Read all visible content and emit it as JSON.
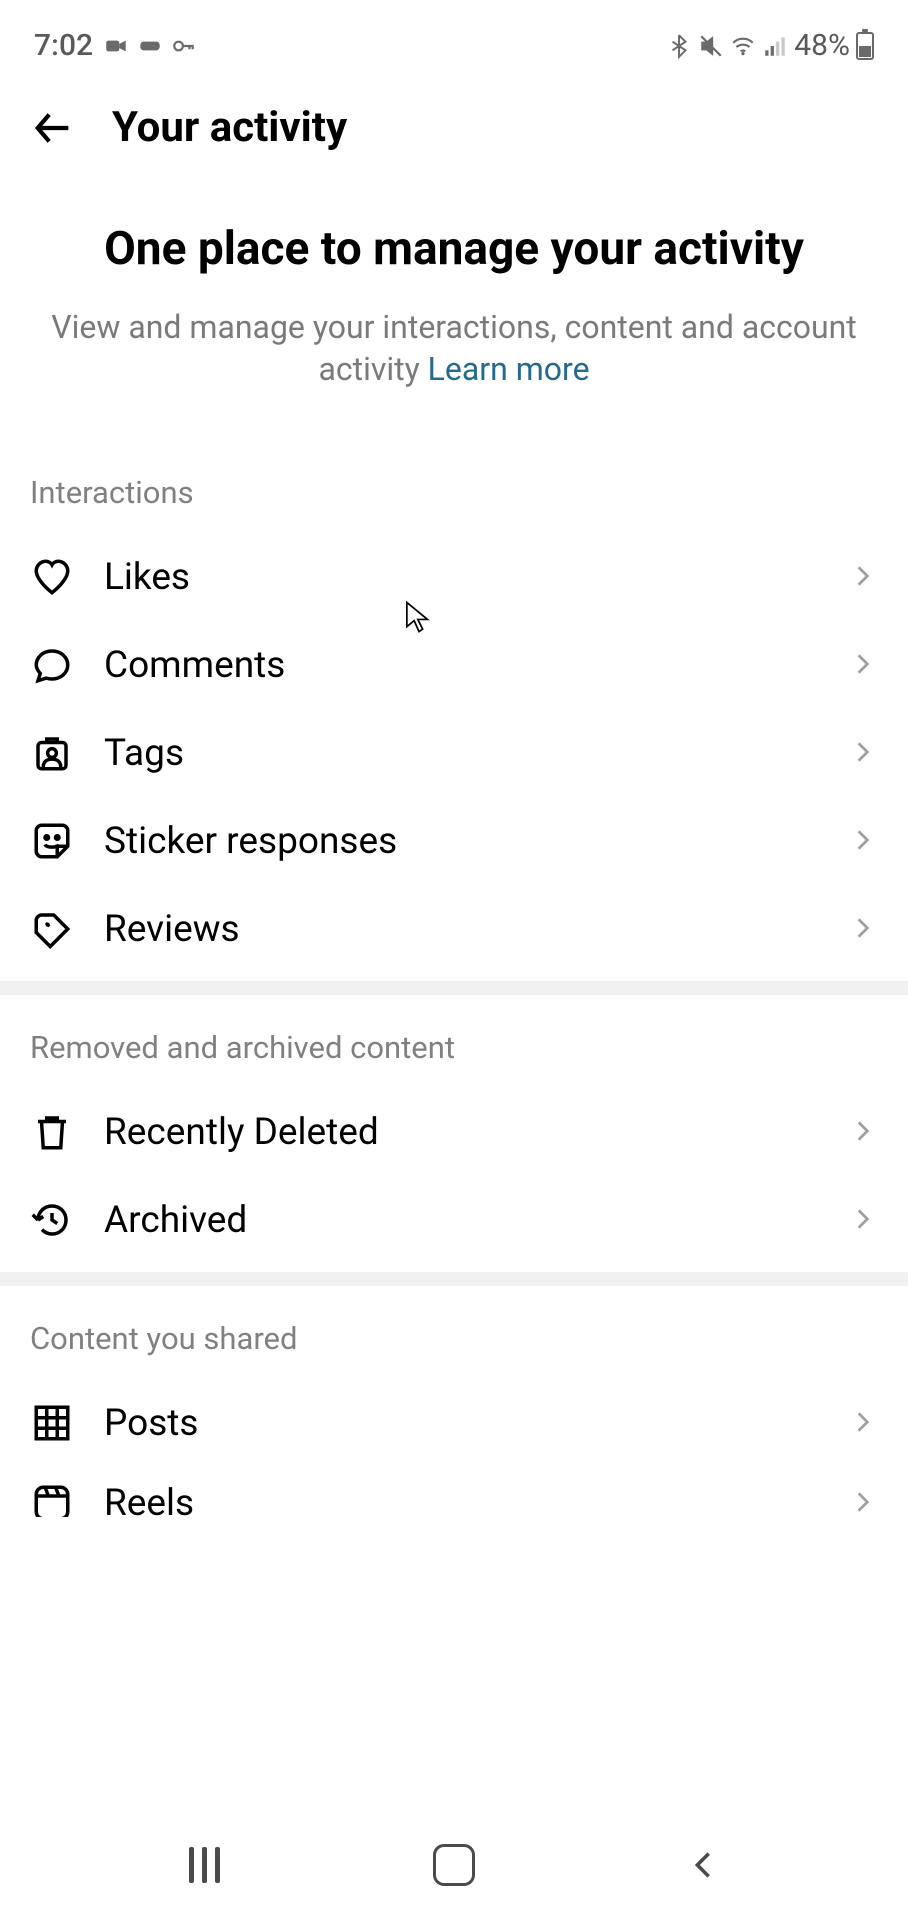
{
  "statusbar": {
    "time": "7:02",
    "battery": "48%"
  },
  "header": {
    "title": "Your activity"
  },
  "intro": {
    "title": "One place to manage your activity",
    "subtitle_prefix": "View and manage your interactions, content and account activity ",
    "learn_more": "Learn more"
  },
  "sections": {
    "interactions": {
      "title": "Interactions",
      "items": [
        {
          "label": "Likes"
        },
        {
          "label": "Comments"
        },
        {
          "label": "Tags"
        },
        {
          "label": "Sticker responses"
        },
        {
          "label": "Reviews"
        }
      ]
    },
    "removed": {
      "title": "Removed and archived content",
      "items": [
        {
          "label": "Recently Deleted"
        },
        {
          "label": "Archived"
        }
      ]
    },
    "shared": {
      "title": "Content you shared",
      "items": [
        {
          "label": "Posts"
        },
        {
          "label": "Reels"
        }
      ]
    }
  }
}
